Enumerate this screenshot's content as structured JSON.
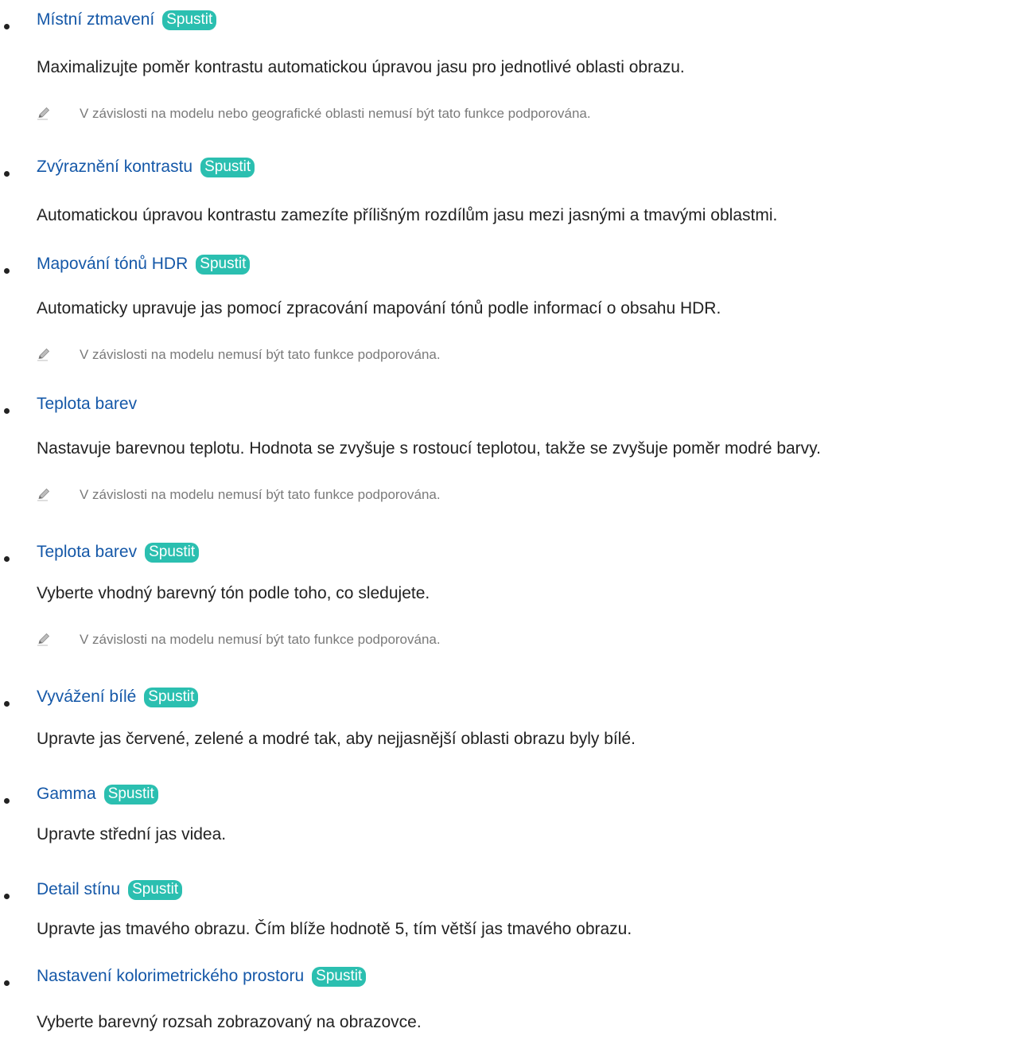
{
  "run_label": "Spustit",
  "items": [
    {
      "title": "Místní ztmavení",
      "has_run": true,
      "description": "Maximalizujte poměr kontrastu automatickou úpravou jasu pro jednotlivé oblasti obrazu.",
      "note": "V závislosti na modelu nebo geografické oblasti nemusí být tato funkce podporována."
    },
    {
      "title": "Zvýraznění kontrastu",
      "has_run": true,
      "description": "Automatickou úpravou kontrastu zamezíte přílišným rozdílům jasu mezi jasnými a tmavými oblastmi."
    },
    {
      "title": "Mapování tónů HDR",
      "has_run": true,
      "description": "Automaticky upravuje jas pomocí zpracování mapování tónů podle informací o obsahu HDR.",
      "note": "V závislosti na modelu nemusí být tato funkce podporována."
    },
    {
      "title": "Teplota barev",
      "has_run": false,
      "description": "Nastavuje barevnou teplotu. Hodnota se zvyšuje s rostoucí teplotou, takže se zvyšuje poměr modré barvy.",
      "note": "V závislosti na modelu nemusí být tato funkce podporována."
    },
    {
      "title": "Teplota barev",
      "has_run": true,
      "description": "Vyberte vhodný barevný tón podle toho, co sledujete.",
      "note": "V závislosti na modelu nemusí být tato funkce podporována."
    },
    {
      "title": "Vyvážení bílé",
      "has_run": true,
      "description": "Upravte jas červené, zelené a modré tak, aby nejjasnější oblasti obrazu byly bílé."
    },
    {
      "title": "Gamma",
      "has_run": true,
      "description": "Upravte střední jas videa."
    },
    {
      "title": "Detail stínu",
      "has_run": true,
      "description": "Upravte jas tmavého obrazu. Čím blíže hodnotě 5, tím větší jas tmavého obrazu."
    },
    {
      "title": "Nastavení kolorimetrického prostoru",
      "has_run": true,
      "description": "Vyberte barevný rozsah zobrazovaný na obrazovce."
    }
  ],
  "colors": {
    "title": "#1558a8",
    "run_badge": "#2bbfb0",
    "body_text": "#222222",
    "note_text": "#7a7a7a"
  },
  "icons": {
    "note": "pencil-icon"
  }
}
